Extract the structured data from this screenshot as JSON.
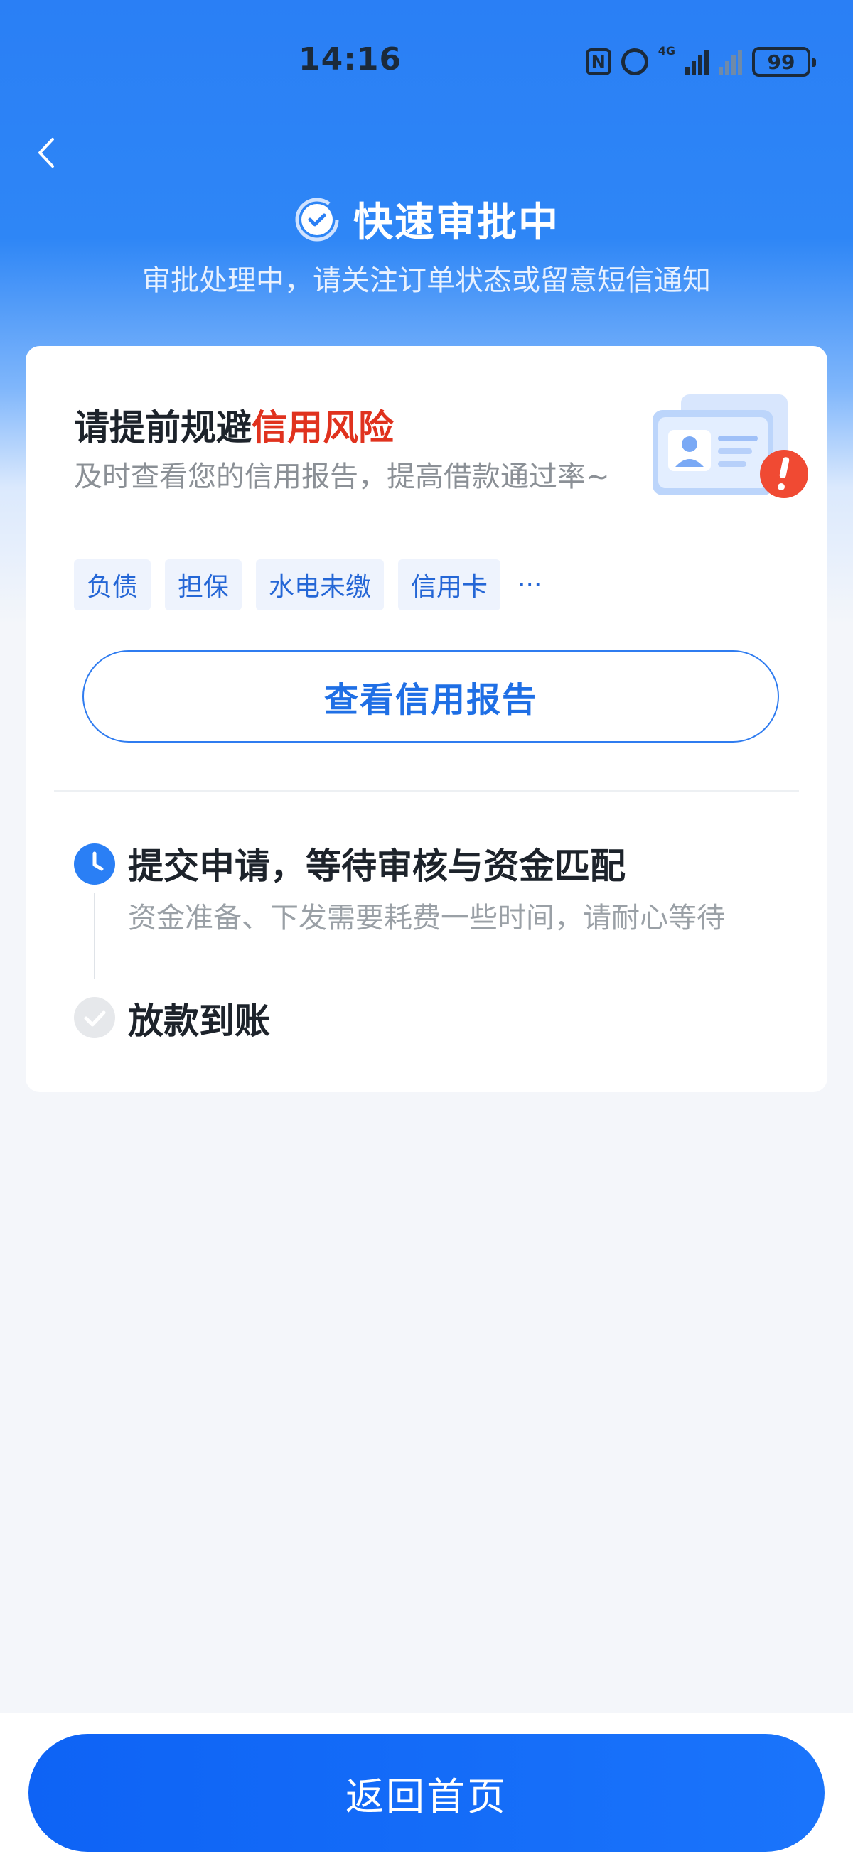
{
  "status_bar": {
    "time": "14:16",
    "network_label": "4G",
    "battery": "99",
    "icons": [
      "nfc-icon",
      "alarm-icon",
      "signal-icon",
      "signal-off-icon",
      "battery-icon"
    ]
  },
  "header": {
    "title": "快速审批中",
    "subtitle": "审批处理中，请关注订单状态或留意短信通知",
    "back_icon": "chevron-left-icon",
    "title_icon": "check-circle-icon"
  },
  "risk_card": {
    "title_prefix": "请提前规避",
    "title_highlight": "信用风险",
    "description": "及时查看您的信用报告，提高借款通过率~",
    "tags": [
      "负债",
      "担保",
      "水电未缴",
      "信用卡"
    ],
    "more": "···",
    "report_button": "查看信用报告",
    "illustration": "credit-report-warning-illustration"
  },
  "steps": [
    {
      "title": "提交申请，等待审核与资金匹配",
      "description": "资金准备、下发需要耗费一些时间，请耐心等待",
      "status": "in-progress",
      "icon": "clock-icon"
    },
    {
      "title": "放款到账",
      "status": "pending",
      "icon": "check-circle-icon"
    }
  ],
  "footer": {
    "home_button": "返回首页"
  },
  "colors": {
    "primary": "#1a74fb",
    "highlight_red": "#e0321e",
    "header_blue": "#2a7ff5"
  }
}
